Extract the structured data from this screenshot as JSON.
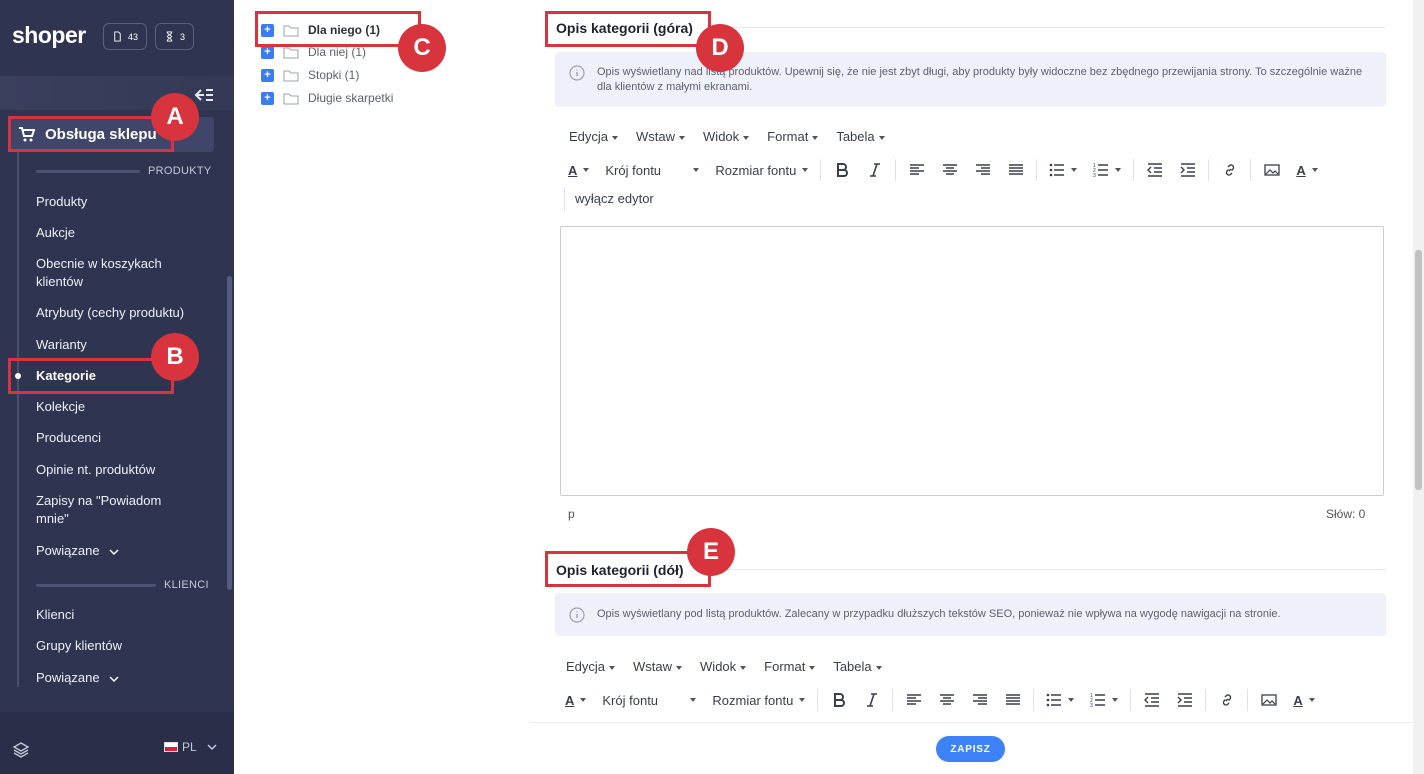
{
  "sidebar": {
    "logo": "shoper",
    "badge_orders": "43",
    "badge_tasks": "3",
    "shop_item": "Obsługa sklepu",
    "section_products": "PRODUKTY",
    "section_clients": "KLIENCI",
    "items": [
      {
        "label": "Produkty"
      },
      {
        "label": "Aukcje"
      },
      {
        "label": "Obecnie w koszykach klientów"
      },
      {
        "label": "Atrybuty (cechy produktu)"
      },
      {
        "label": "Warianty"
      },
      {
        "label": "Kategorie"
      },
      {
        "label": "Kolekcje"
      },
      {
        "label": "Producenci"
      },
      {
        "label": "Opinie nt. produktów"
      },
      {
        "label": "Zapisy na \"Powiadom mnie\""
      },
      {
        "label": "Powiązane"
      }
    ],
    "client_items": [
      {
        "label": "Klienci"
      },
      {
        "label": "Grupy klientów"
      },
      {
        "label": "Powiązane"
      }
    ],
    "lang": "PL"
  },
  "tree": {
    "items": [
      {
        "label": "Dla niego (1)"
      },
      {
        "label": "Dla niej (1)"
      },
      {
        "label": "Stopki (1)"
      },
      {
        "label": "Długie skarpetki"
      }
    ]
  },
  "top_section": {
    "title": "Opis kategorii (góra)",
    "info": "Opis wyświetlany nad listą produktów. Upewnij się, że nie jest zbyt długi, aby produkty były widoczne bez zbędnego przewijania strony. To szczególnie ważne dla klientów z małymi ekranami.",
    "menu": [
      "Edycja",
      "Wstaw",
      "Widok",
      "Format",
      "Tabela"
    ],
    "font_family": "Krój fontu",
    "font_size": "Rozmiar fontu",
    "disable_editor": "wyłącz edytor",
    "status_path": "p",
    "word_count": "Słów: 0"
  },
  "bottom_section": {
    "title": "Opis kategorii (dół)",
    "info": "Opis wyświetlany pod listą produktów. Zalecany w przypadku dłuższych tekstów SEO, ponieważ nie wpływa na wygodę nawigacji na stronie.",
    "menu": [
      "Edycja",
      "Wstaw",
      "Widok",
      "Format",
      "Tabela"
    ],
    "font_family": "Krój fontu",
    "font_size": "Rozmiar fontu"
  },
  "save_label": "ZAPISZ",
  "callouts": {
    "a": "A",
    "b": "B",
    "c": "C",
    "d": "D",
    "e": "E"
  },
  "colors": {
    "sidebar": "#2f3450",
    "accent": "#3e82f7",
    "annotation": "#d8343d"
  }
}
